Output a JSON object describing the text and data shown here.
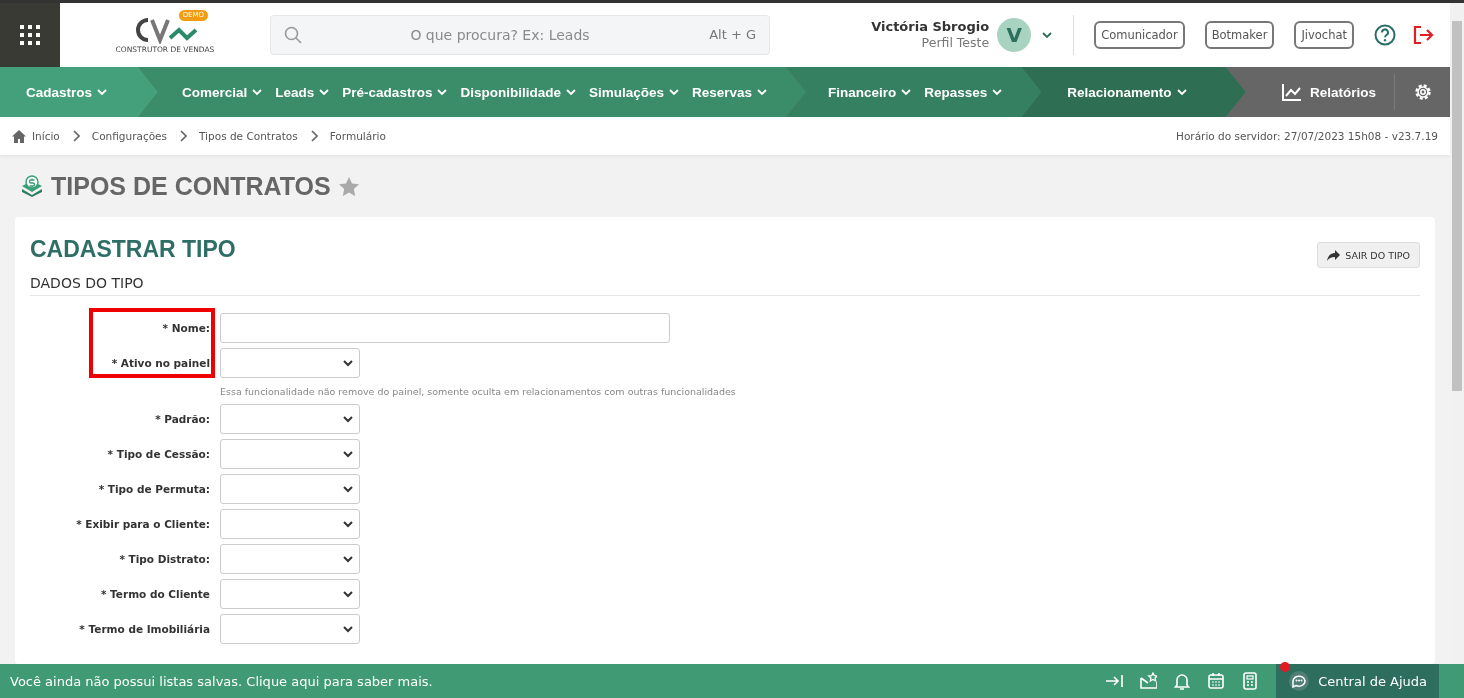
{
  "header": {
    "search": {
      "placeholder": "O que procura? Ex: Leads",
      "shortcut": "Alt + G"
    },
    "user": {
      "name": "Victória Sbrogio",
      "profile": "Perfil Teste",
      "initial": "V"
    },
    "buttons": [
      "Comunicador",
      "Botmaker",
      "Jivochat"
    ],
    "logo": {
      "badge": "DEMO",
      "tagline": "CONSTRUTOR DE VENDAS"
    }
  },
  "nav": {
    "groups": [
      {
        "color": "#44a07a",
        "items": [
          "Cadastros"
        ]
      },
      {
        "color": "#3b8c69",
        "items": [
          "Comercial",
          "Leads",
          "Pré-cadastros",
          "Disponibilidade",
          "Simulações",
          "Reservas"
        ]
      },
      {
        "color": "#368062",
        "items": [
          "Financeiro",
          "Repasses"
        ]
      },
      {
        "color": "#2e6f53",
        "items": [
          "Relacionamento"
        ]
      }
    ],
    "reports": "Relatórios"
  },
  "breadcrumb": [
    "Início",
    "Configurações",
    "Tipos de Contratos",
    "Formulário"
  ],
  "server_time": "Horário do servidor: 27/07/2023 15h08 - v23.7.19",
  "page_title": "TIPOS DE CONTRATOS",
  "card": {
    "title": "CADASTRAR TIPO",
    "exit_button": "SAIR DO TIPO",
    "section": "DADOS DO TIPO",
    "fields": [
      {
        "kind": "text",
        "label": "* Nome:",
        "highlighted": true
      },
      {
        "kind": "select",
        "label": "* Ativo no painel",
        "highlighted": true,
        "hint": "Essa funcionalidade não remove do painel, somente oculta em relacionamentos com outras funcionalidades"
      },
      {
        "kind": "select",
        "label": "* Padrão:",
        "highlighted": false
      },
      {
        "kind": "select",
        "label": "* Tipo de Cessão:",
        "highlighted": false
      },
      {
        "kind": "select",
        "label": "* Tipo de Permuta:",
        "highlighted": false
      },
      {
        "kind": "select",
        "label": "* Exibir para o Cliente:",
        "highlighted": false
      },
      {
        "kind": "select",
        "label": "* Tipo Distrato:",
        "highlighted": false
      },
      {
        "kind": "select",
        "label": "* Termo do Cliente",
        "highlighted": false
      },
      {
        "kind": "select",
        "label": "* Termo de Imobiliária",
        "highlighted": false
      }
    ]
  },
  "footer": {
    "message": "Você ainda não possui listas salvas. Clique aqui para saber mais.",
    "help": "Central de Ajuda",
    "help_notification": true
  }
}
